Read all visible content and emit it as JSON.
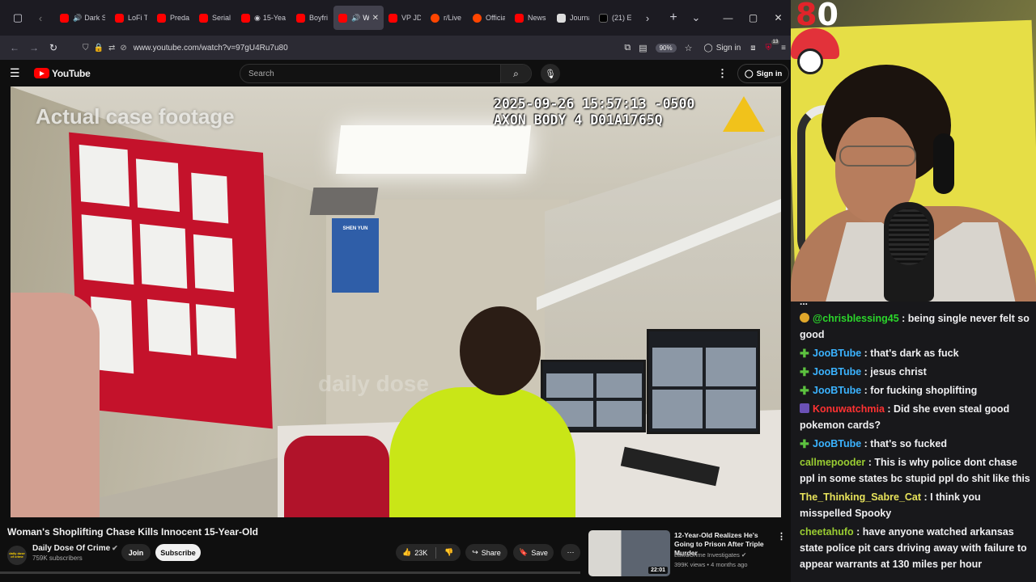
{
  "browser": {
    "tabs": [
      {
        "label": "Dark S",
        "favicon": "youtube",
        "audio": true
      },
      {
        "label": "LoFi Ti",
        "favicon": "youtube"
      },
      {
        "label": "Preda",
        "favicon": "youtube"
      },
      {
        "label": "Serial",
        "favicon": "youtube"
      },
      {
        "label": "15-Yea",
        "favicon": "youtube",
        "audio": true
      },
      {
        "label": "Boyfri",
        "favicon": "youtube"
      },
      {
        "label": "Wo",
        "favicon": "youtube",
        "audio": true,
        "active": true
      },
      {
        "label": "VP JD",
        "favicon": "youtube"
      },
      {
        "label": "r/Live",
        "favicon": "reddit"
      },
      {
        "label": "Officia",
        "favicon": "reddit"
      },
      {
        "label": "News",
        "favicon": "youtube"
      },
      {
        "label": "Journa",
        "favicon": "journal"
      },
      {
        "label": "(21) E",
        "favicon": "x"
      }
    ],
    "url": "www.youtube.com/watch?v=97gU4Ru7u80",
    "zoom": "90%",
    "signin": "Sign in",
    "extension_badge": "13"
  },
  "youtube": {
    "logo_text": "YouTube",
    "search_placeholder": "Search",
    "signin": "Sign in",
    "video_overlay": {
      "title": "Actual case footage",
      "timestamp_line1": "2025-09-26 15:57:13 -0500",
      "timestamp_line2": "AXON BODY 4 D01A1765Q",
      "watermark": "daily dose"
    },
    "poster_text": "SHEN YUN",
    "video_title": "Woman's Shoplifting Chase Kills Innocent 15-Year-Old",
    "channel": {
      "name": "Daily Dose Of Crime",
      "subscribers": "759K subscribers",
      "avatar_text": "daily dose of crime"
    },
    "join": "Join",
    "subscribe": "Subscribe",
    "likes": "23K",
    "share": "Share",
    "save": "Save",
    "recommended": {
      "title": "12-Year-Old Realizes He's Going to Prison After Triple Murder",
      "channel": "Law&Crime Investigates",
      "meta": "399K views • 4 months ago",
      "duration": "22:01"
    }
  },
  "stream": {
    "score": "80"
  },
  "chat": {
    "cutoff_text": "...",
    "messages": [
      {
        "user": "@chrisblessing45",
        "text": "being single never felt so good",
        "color": "#2bd62b",
        "badge": "circle"
      },
      {
        "user": "JooBTube",
        "text": "that's dark as fuck",
        "color": "#3bb3ff",
        "badge": "plus"
      },
      {
        "user": "JooBTube",
        "text": "jesus christ",
        "color": "#3bb3ff",
        "badge": "plus"
      },
      {
        "user": "JooBTube",
        "text": "for fucking shoplifting",
        "color": "#3bb3ff",
        "badge": "plus"
      },
      {
        "user": "Konuwatchmia",
        "text": "Did she even steal good pokemon cards?",
        "color": "#ff3232",
        "badge": "box"
      },
      {
        "user": "JooBTube",
        "text": "that's so fucked",
        "color": "#3bb3ff",
        "badge": "plus"
      },
      {
        "user": "callmepooder",
        "text": "This is why police dont chase ppl in some states bc stupid ppl do shit like this",
        "color": "#9acd32",
        "badge": ""
      },
      {
        "user": "The_Thinking_Sabre_Cat",
        "text": "I think you misspelled Spooky",
        "color": "#e8e35b",
        "badge": ""
      },
      {
        "user": "cheetahufo",
        "text": "have anyone watched arkansas state police pit cars driving away with failure to appear warrants at 130 miles per hour",
        "color": "#9acd32",
        "badge": ""
      }
    ]
  }
}
